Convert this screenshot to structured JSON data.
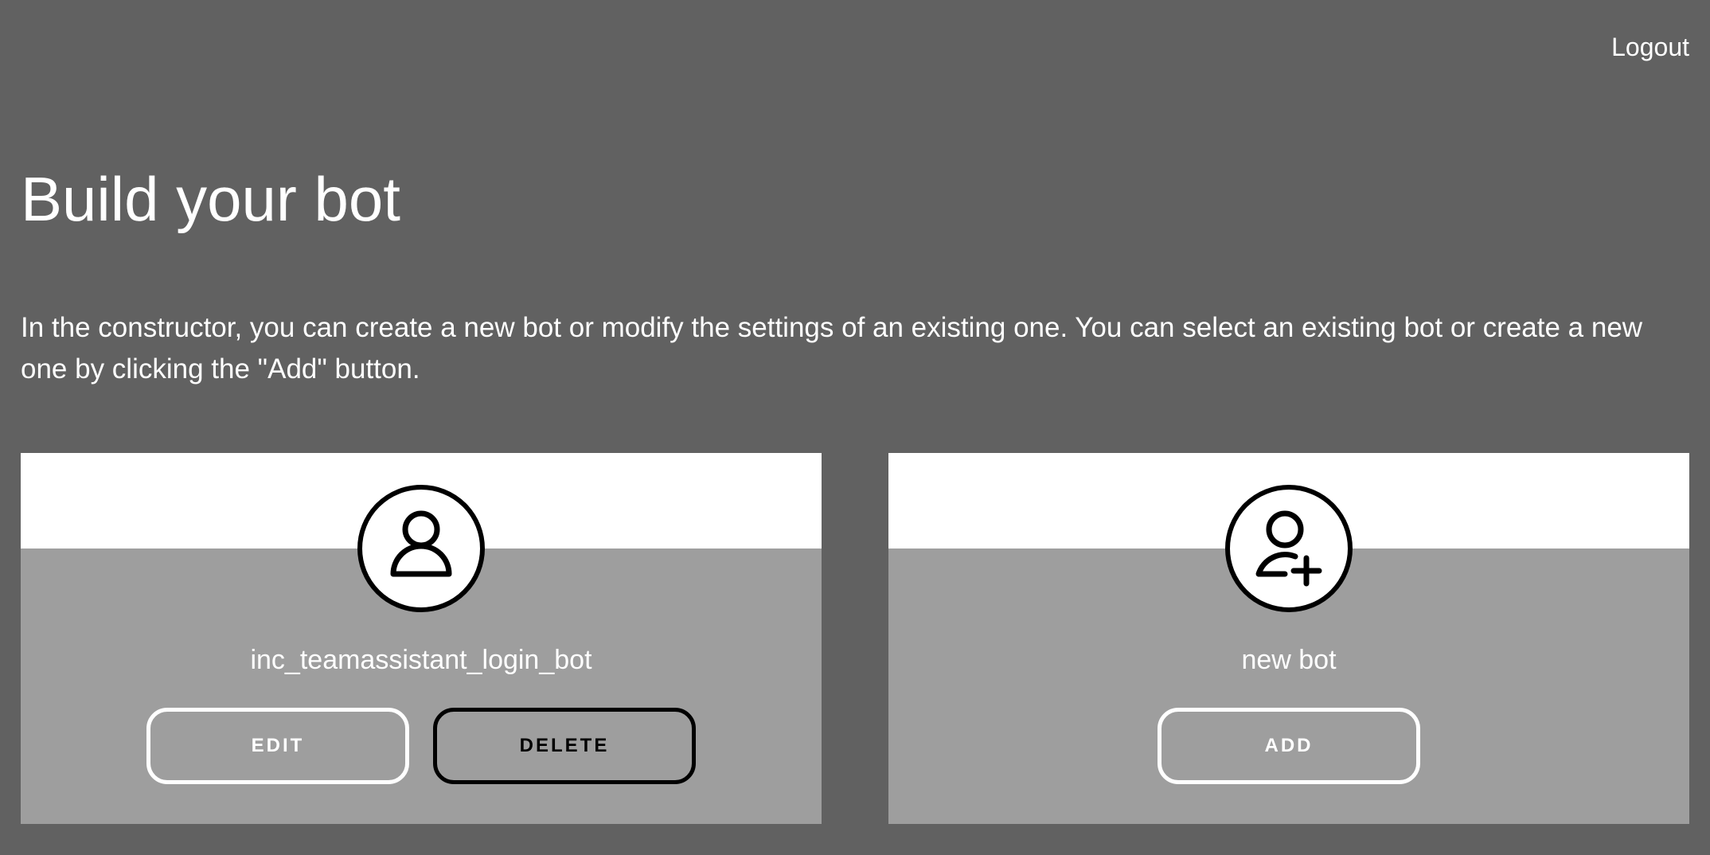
{
  "header": {
    "logout_label": "Logout"
  },
  "main": {
    "title": "Build your bot",
    "description": "In the constructor, you can create a new bot or modify the settings of an existing one. You can select an existing bot or create a new one by clicking the \"Add\" button."
  },
  "cards": [
    {
      "name": "inc_teamassistant_login_bot",
      "icon": "user-icon",
      "buttons": {
        "edit_label": "EDIT",
        "delete_label": "DELETE"
      }
    },
    {
      "name": "new bot",
      "icon": "user-add-icon",
      "buttons": {
        "add_label": "ADD"
      }
    }
  ],
  "colors": {
    "background": "#616161",
    "card_body": "#9e9e9e",
    "card_top": "#ffffff",
    "text": "#ffffff",
    "outline_dark": "#000000"
  }
}
